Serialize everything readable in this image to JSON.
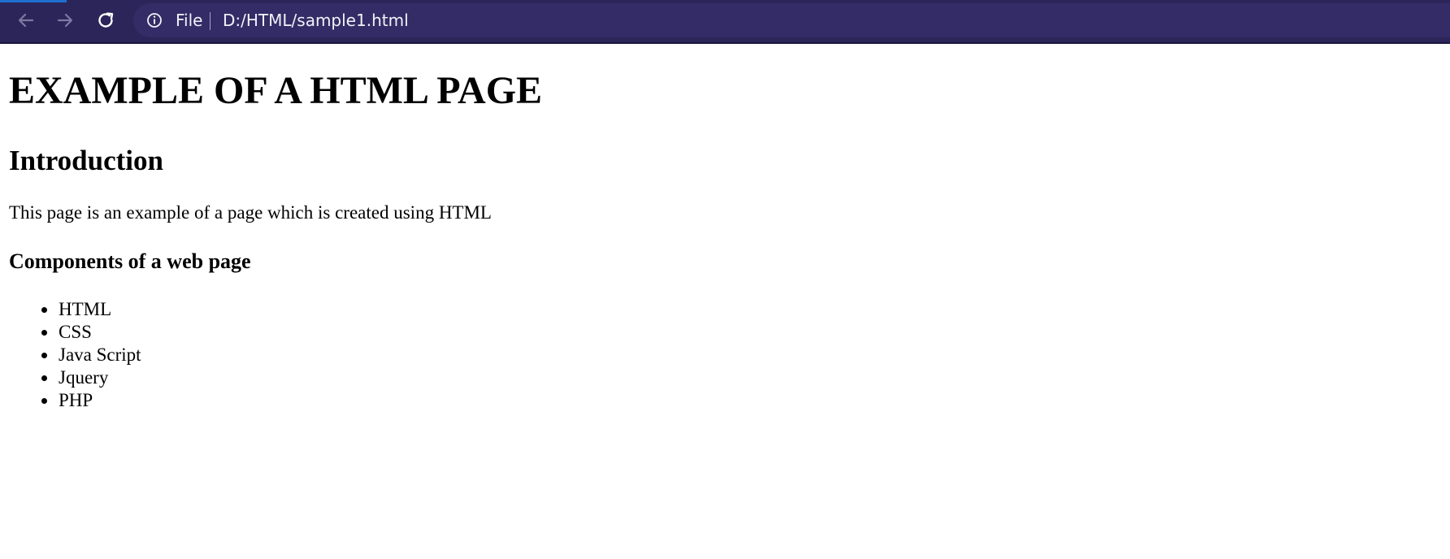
{
  "browser": {
    "address": {
      "scheme_label": "File",
      "url": "D:/HTML/sample1.html"
    },
    "icons": {
      "back": "arrow-left-icon",
      "forward": "arrow-right-icon",
      "reload": "reload-icon",
      "info": "info-icon"
    },
    "colors": {
      "toolbar": "#2b2559",
      "address_bar": "#332c66"
    }
  },
  "page": {
    "title": "EXAMPLE OF A HTML PAGE",
    "intro_heading": "Introduction",
    "intro_text": "This page is an example of a page which is created using HTML",
    "components_heading": "Components of a web page",
    "components": [
      "HTML",
      "CSS",
      "Java Script",
      "Jquery",
      "PHP"
    ]
  }
}
